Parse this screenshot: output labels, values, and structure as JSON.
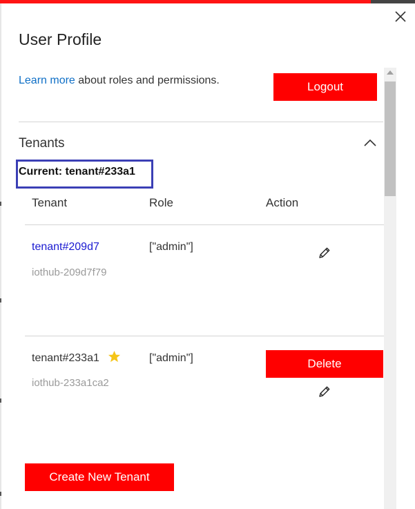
{
  "panel": {
    "title": "User Profile",
    "close_icon": "close-icon"
  },
  "intro": {
    "link_text": "Learn more",
    "text": " about roles and permissions."
  },
  "logout_label": "Logout",
  "tenants": {
    "section_title": "Tenants",
    "collapse_icon": "chevron-up-icon",
    "current_label": "Current: tenant#233a1",
    "columns": [
      "Tenant",
      "Role",
      "Action"
    ],
    "rows": [
      {
        "name": "tenant#209d7",
        "sub": "iothub-209d7f79",
        "role": "[\"admin\"]",
        "edit_icon": "pencil-icon"
      },
      {
        "name": "tenant#233a1",
        "sub": "iothub-233a1ca2",
        "role": "[\"admin\"]",
        "star_icon": "star-icon",
        "delete_label": "Delete",
        "edit_icon": "pencil-icon"
      }
    ],
    "create_label": "Create New Tenant"
  },
  "colors": {
    "accent_red": "#ff0000",
    "link_blue": "#0f6fc6",
    "tenant_link": "#1a1ad1",
    "highlight_border": "#3b3fb5",
    "star": "#f5c518"
  }
}
